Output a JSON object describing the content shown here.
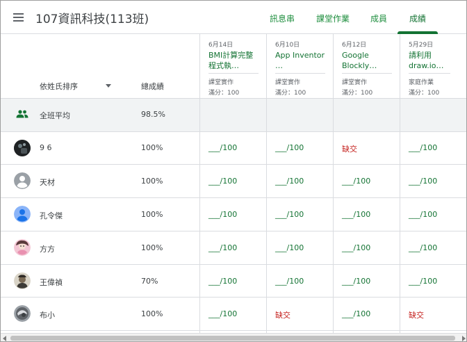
{
  "header": {
    "class_title": "107資訊科技(113班)",
    "tabs": [
      {
        "label": "訊息串"
      },
      {
        "label": "課堂作業"
      },
      {
        "label": "成員"
      },
      {
        "label": "成績",
        "active": true
      }
    ]
  },
  "table": {
    "sort_label": "依姓氏排序",
    "total_header": "總成績",
    "assignments": [
      {
        "date": "6月14日",
        "title": "BMI計算完整程式執…",
        "type": "課堂實作",
        "points": "滿分：100"
      },
      {
        "date": "6月10日",
        "title": "App Inventor …",
        "type": "課堂實作",
        "points": "滿分：100"
      },
      {
        "date": "6月12日",
        "title": "Google Blockly…",
        "type": "課堂實作",
        "points": "滿分：100"
      },
      {
        "date": "5月29日",
        "title": "請利用 draw.io…",
        "type": "家庭作業",
        "points": "滿分：100"
      }
    ],
    "class_average": {
      "label": "全班平均",
      "value": "98.5%"
    },
    "students": [
      {
        "name": "9 6",
        "total": "100%",
        "grades": [
          "___/100",
          "___/100",
          "缺交",
          "___/100"
        ]
      },
      {
        "name": "天材",
        "total": "100%",
        "grades": [
          "___/100",
          "___/100",
          "___/100",
          "___/100"
        ]
      },
      {
        "name": "孔令傑",
        "total": "100%",
        "grades": [
          "___/100",
          "___/100",
          "___/100",
          "___/100"
        ]
      },
      {
        "name": "方方",
        "total": "100%",
        "grades": [
          "___/100",
          "___/100",
          "___/100",
          "___/100"
        ]
      },
      {
        "name": "王偉禎",
        "total": "70%",
        "grades": [
          "___/100",
          "___/100",
          "___/100",
          "___/100"
        ]
      },
      {
        "name": "布小",
        "total": "100%",
        "grades": [
          "___/100",
          "缺交",
          "___/100",
          "缺交"
        ]
      }
    ]
  },
  "colors": {
    "accent_green": "#137333",
    "missing_red": "#c5221f",
    "average_row_bg": "#f1f3f4"
  },
  "icons": {
    "menu": "menu-icon",
    "sort": "sort-caret-icon",
    "class_average": "people-icon",
    "student": "avatar"
  }
}
